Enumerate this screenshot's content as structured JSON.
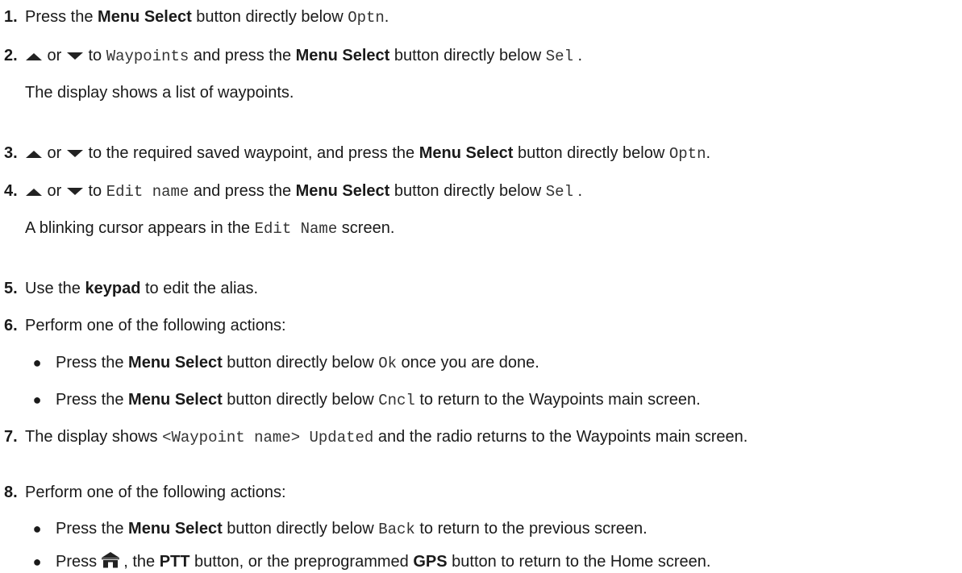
{
  "icons": {
    "up": "up-arrow-icon",
    "down": "down-arrow-icon",
    "home": "home-icon"
  },
  "steps": [
    {
      "num": "1.",
      "p1": "Press the ",
      "b1": "Menu Select",
      "p2": " button directly below ",
      "m1": "Optn",
      "p3": "."
    },
    {
      "num": "2.",
      "or": " or ",
      "p1": " to ",
      "m1": "Waypoints",
      "p2": " and press the ",
      "b1": "Menu Select",
      "p3": " button directly below ",
      "m2": "Sel",
      "p4": " .",
      "note": "The display shows a list of waypoints."
    },
    {
      "num": "3.",
      "or": " or ",
      "p1": " to the required saved waypoint, and press the ",
      "b1": "Menu Select",
      "p2": " button directly below ",
      "m1": "Optn",
      "p3": "."
    },
    {
      "num": "4.",
      "or": " or ",
      "p1": " to ",
      "m1": "Edit name",
      "p2": " and press the ",
      "b1": "Menu Select",
      "p3": " button directly below ",
      "m2": "Sel",
      "p4": " .",
      "note_p1": "A blinking cursor appears in the ",
      "note_m1": "Edit Name",
      "note_p2": " screen."
    },
    {
      "num": "5.",
      "p1": "Use the ",
      "b1": "keypad",
      "p2": " to edit the alias."
    },
    {
      "num": "6.",
      "text": "Perform one of the following actions:",
      "bullets": [
        {
          "p1": "Press the ",
          "b1": "Menu Select",
          "p2": " button directly below ",
          "m1": "Ok",
          "p3": " once you are done."
        },
        {
          "p1": "Press the ",
          "b1": "Menu Select",
          "p2": " button directly below ",
          "m1": "Cncl",
          "p3": " to return to the Waypoints main screen."
        }
      ]
    },
    {
      "num": "7.",
      "p1": "The display shows ",
      "m1": "<Waypoint name> Updated",
      "p2": " and the radio returns to the Waypoints main screen."
    },
    {
      "num": "8.",
      "text": "Perform one of the following actions:",
      "bullets": [
        {
          "p1": "Press the ",
          "b1": "Menu Select",
          "p2": " button directly below ",
          "m1": "Back",
          "p3": " to return to the previous screen."
        },
        {
          "p1": "Press ",
          "p2": " , the ",
          "b1": "PTT",
          "p3": " button, or the preprogrammed ",
          "b2": "GPS",
          "p4": " button to return to the Home screen."
        }
      ]
    }
  ]
}
